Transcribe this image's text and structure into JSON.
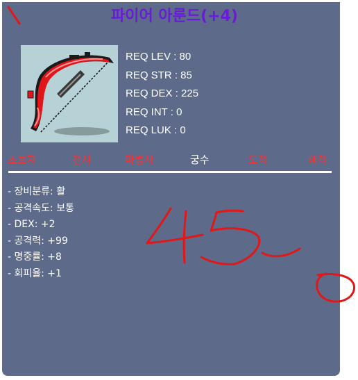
{
  "item": {
    "name": "파이어 아룬드(+4)",
    "icon": "bow-icon"
  },
  "requirements": [
    {
      "label": "REQ LEV",
      "value": "80"
    },
    {
      "label": "REQ STR",
      "value": "85"
    },
    {
      "label": "REQ DEX",
      "value": "225"
    },
    {
      "label": "REQ INT",
      "value": "0"
    },
    {
      "label": "REQ LUK",
      "value": "0"
    }
  ],
  "requirement_lines": [
    "REQ LEV : 80",
    "REQ STR : 85",
    "REQ DEX : 225",
    "REQ INT : 0",
    "REQ LUK : 0"
  ],
  "jobs": [
    {
      "label": "초보자",
      "available": false
    },
    {
      "label": "전사",
      "available": false
    },
    {
      "label": "마법사",
      "available": false
    },
    {
      "label": "궁수",
      "available": true
    },
    {
      "label": "도적",
      "available": false
    },
    {
      "label": "해적",
      "available": false
    }
  ],
  "stats": [
    "- 장비분류: 활",
    "- 공격속도: 보통",
    "- DEX: +2",
    "- 공격력: +99",
    "- 명중률: +8",
    "- 회피율: +1"
  ],
  "colors": {
    "panel": "#5d6a89",
    "title": "#6a1bd9",
    "unavailable_job": "#ff3030",
    "available_job": "#ffffff",
    "icon_background": "#b7d2d6",
    "annotation": "#e01818"
  }
}
